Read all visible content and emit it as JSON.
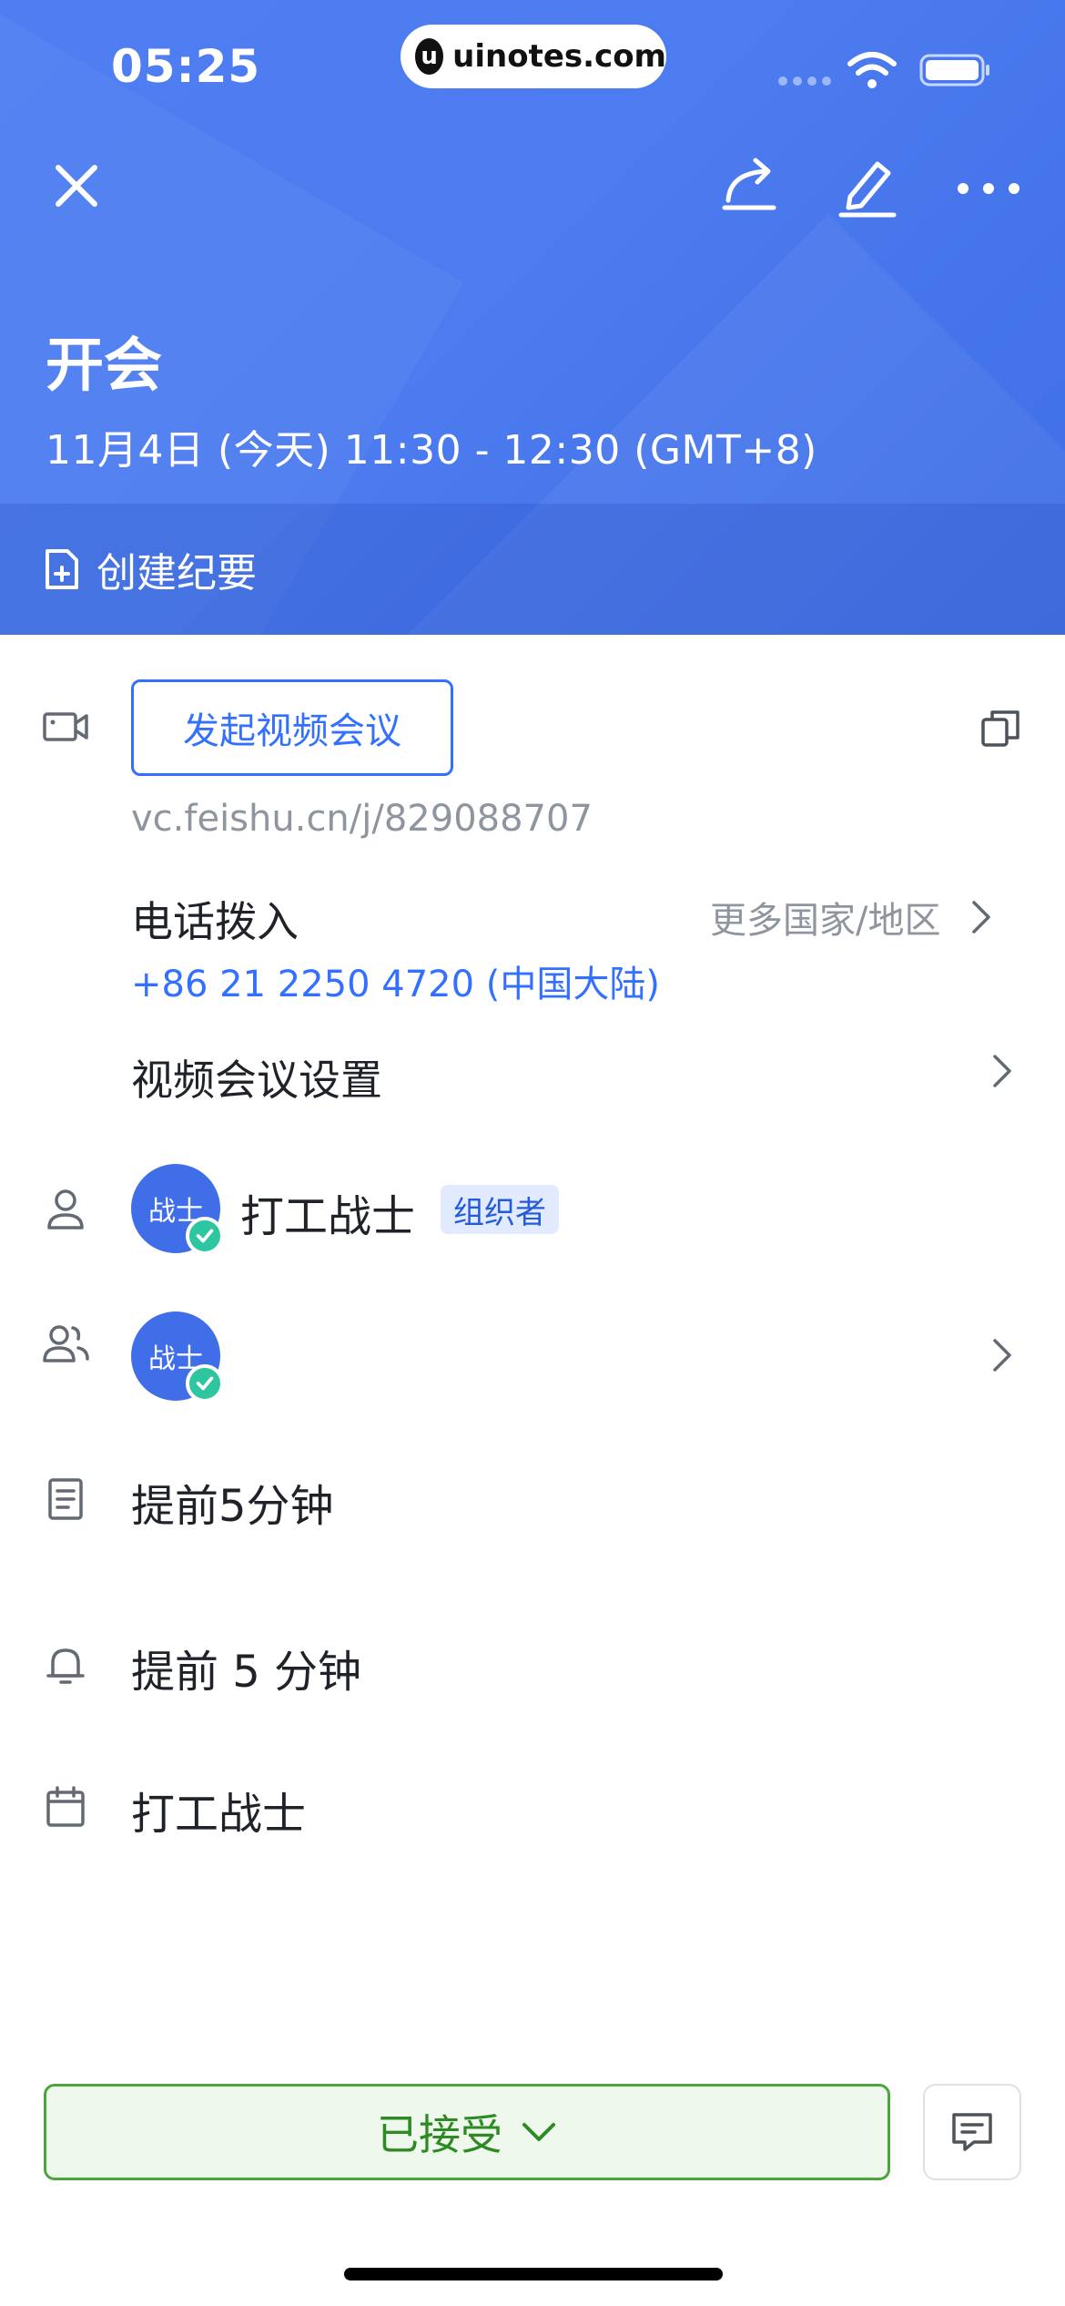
{
  "status_bar": {
    "time": "05:25",
    "watermark": "uinotes.com"
  },
  "header": {
    "title": "开会",
    "time_range": "11月4日 (今天) 11:30 - 12:30 (GMT+8)",
    "notes_label": "创建纪要",
    "icons": [
      "close-icon",
      "share-icon",
      "edit-icon",
      "more-icon"
    ]
  },
  "video_meeting": {
    "start_button": "发起视频会议",
    "link": "vc.feishu.cn/j/829088707",
    "dial_in_label": "电话拨入",
    "more_countries": "更多国家/地区",
    "phone_number": "+86 21 2250 4720 (中国大陆)",
    "settings_label": "视频会议设置"
  },
  "organizer": {
    "avatar_text": "战士",
    "name": "打工战士",
    "badge": "组织者"
  },
  "attendees": {
    "avatar_text": "战士"
  },
  "reminder_doc": "提前5分钟",
  "reminder_alarm": "提前 5 分钟",
  "calendar_name": "打工战士",
  "footer": {
    "rsvp_label": "已接受"
  },
  "colors": {
    "header_bg": "#4d7cf0",
    "accent_blue": "#3370ff",
    "accept_green": "#2e8a23",
    "accept_bg": "#eef8ec"
  }
}
